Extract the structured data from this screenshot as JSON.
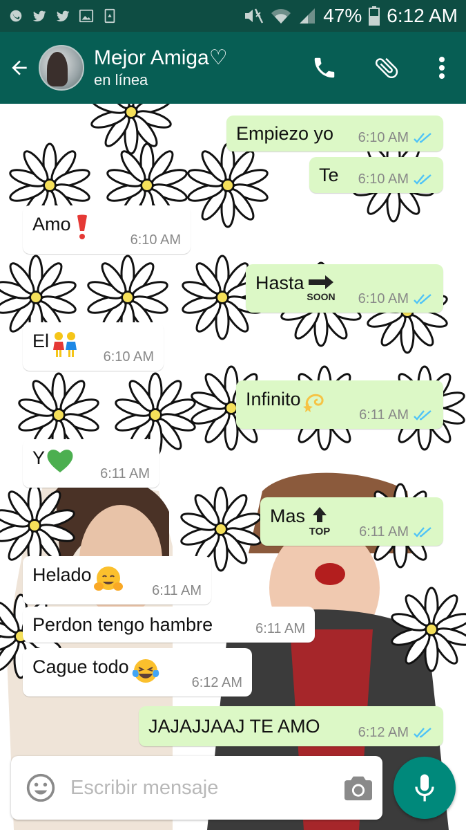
{
  "status_bar": {
    "battery": "47%",
    "time": "6:12 AM",
    "left_icons": [
      "chat-notification-icon",
      "twitter-icon",
      "twitter-icon",
      "image-icon",
      "recycle-icon"
    ],
    "right_icons": [
      "mute-icon",
      "wifi-icon",
      "signal-icon",
      "battery-icon"
    ]
  },
  "header": {
    "contact_name": "Mejor Amiga♡",
    "contact_status": "en línea",
    "colors": {
      "bar": "#075e54",
      "status_bar": "#0e4d43"
    }
  },
  "messages": [
    {
      "dir": "out",
      "text": "Empiezo yo",
      "emoji": "",
      "time": "6:10 AM",
      "read": true
    },
    {
      "dir": "out",
      "text": "Te",
      "emoji": "",
      "time": "6:10 AM",
      "read": true
    },
    {
      "dir": "in",
      "text": "Amo",
      "emoji": "heavy-exclamation-icon",
      "time": "6:10 AM"
    },
    {
      "dir": "out",
      "text": "Hasta",
      "emoji": "soon-arrow-icon",
      "time": "6:10 AM",
      "read": true
    },
    {
      "dir": "in",
      "text": "El",
      "emoji": "two-women-holding-hands-icon",
      "time": "6:10 AM"
    },
    {
      "dir": "out",
      "text": "Infinito",
      "emoji": "dizzy-icon",
      "time": "6:11 AM",
      "read": true
    },
    {
      "dir": "in",
      "text": "Y",
      "emoji": "green-heart-icon",
      "time": "6:11 AM"
    },
    {
      "dir": "out",
      "text": "Mas",
      "emoji": "top-arrow-icon",
      "time": "6:11 AM",
      "read": true
    },
    {
      "dir": "in",
      "text": "Helado",
      "emoji": "hugging-face-icon",
      "time": "6:11 AM"
    },
    {
      "dir": "in",
      "text": "Perdon tengo hambre",
      "emoji": "",
      "time": "6:11 AM"
    },
    {
      "dir": "in",
      "text": "Cague todo",
      "emoji": "tears-of-joy-icon",
      "time": "6:12 AM"
    },
    {
      "dir": "out",
      "text": "JAJAJJAAJ TE AMO",
      "emoji": "",
      "time": "6:12 AM",
      "read": true
    }
  ],
  "composer": {
    "placeholder": "Escribir mensaje"
  },
  "colors": {
    "outgoing_bubble": "#dcf8c6",
    "incoming_bubble": "#ffffff",
    "read_ticks": "#4fc3f7",
    "mic_button": "#00897b"
  }
}
